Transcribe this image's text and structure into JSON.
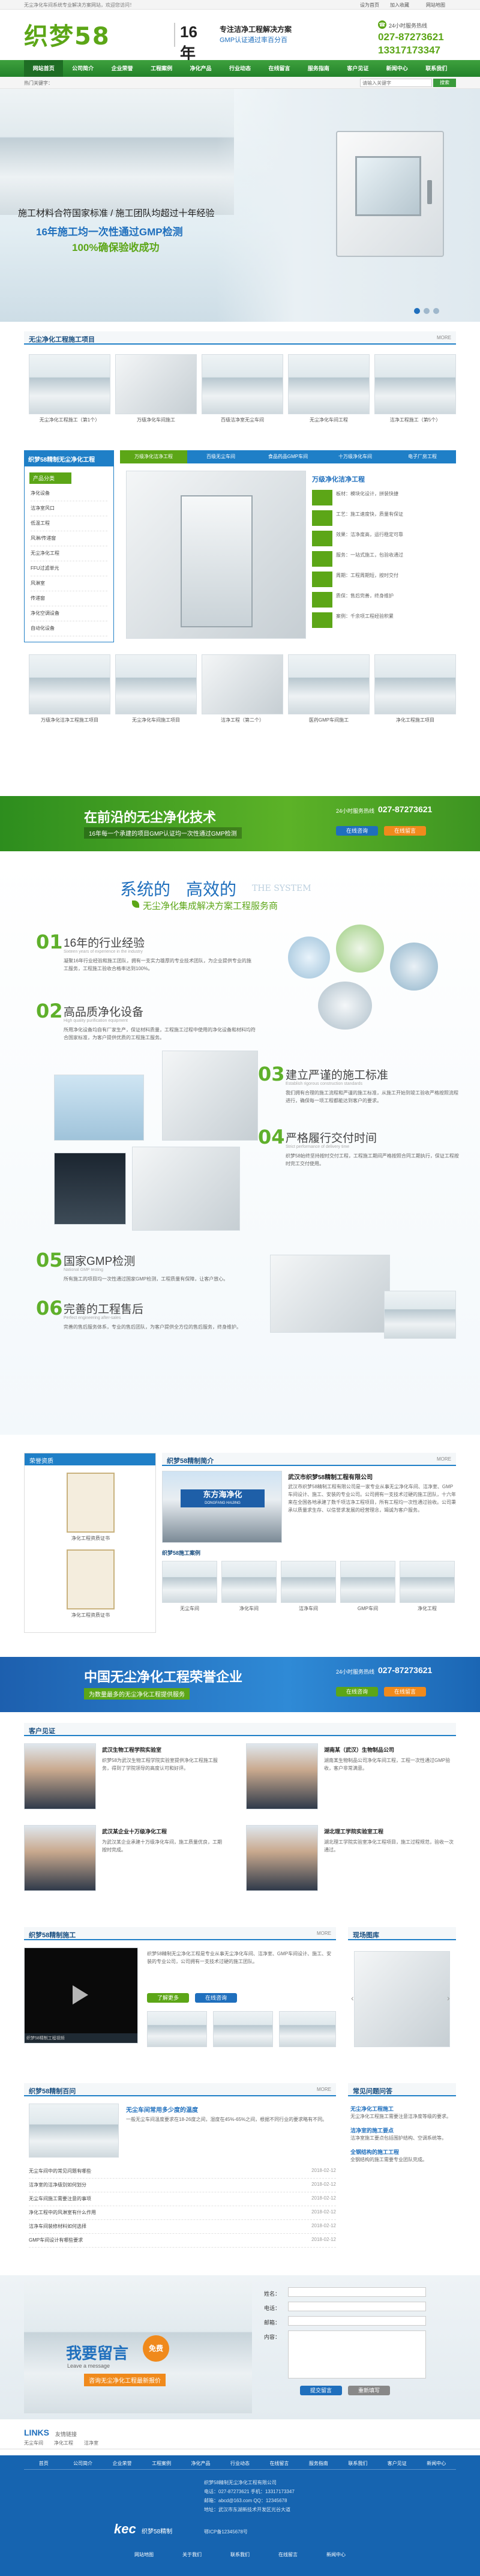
{
  "topbar": {
    "welcome": "无尘净化车间系统专业解决方案网站，欢迎您访问！",
    "links": [
      "设为首页",
      "加入收藏",
      "网站地图"
    ]
  },
  "header": {
    "logo": "织梦58",
    "tag_num": "16年",
    "tag1": "专注洁净工程解决方案",
    "tag2": "GMP认证通过率百分百",
    "hotline_label": "24小时服务热线",
    "phone1": "027-87273621",
    "phone2": "13317173347"
  },
  "nav": [
    "网站首页",
    "公司简介",
    "企业荣誉",
    "工程案例",
    "净化产品",
    "行业动态",
    "在线留言",
    "服务指南",
    "客户见证",
    "新闻中心",
    "联系我们"
  ],
  "search": {
    "label": "热门关键字：",
    "placeholder": "请输入关键字",
    "button": "搜索"
  },
  "banner": {
    "line1": "施工材料合符国家标准 / 施工团队均超过十年经验",
    "line2": "16年施工均一次性通过GMP检测",
    "line3": "100%确保验收成功"
  },
  "cases": {
    "title": "无尘净化工程施工项目",
    "more": "MORE",
    "items": [
      "无尘净化工程施工（第1个）",
      "万级净化车间施工",
      "百级洁净室无尘车间",
      "无尘净化车间工程",
      "洁净工程施工（第5个）"
    ]
  },
  "products": {
    "head": "织梦58精制无尘净化工程",
    "sidebar_title": "产品分类",
    "cats": [
      "净化设备",
      "洁净室风口",
      "低温工程",
      "风淋/传递窗",
      "无尘净化工程",
      "FFU过滤单元",
      "风淋室",
      "传递窗",
      "净化空调设备",
      "自动化设备"
    ],
    "tabs": [
      "万级净化洁净工程",
      "百级无尘车间",
      "食品药品GMP车间",
      "十万级净化车间",
      "电子厂房工程"
    ],
    "feat_title": "万级净化洁净工程",
    "features": [
      "板材：模块化设计，拼装快捷",
      "工艺：施工速度快，质量有保证",
      "效果：洁净度高，运行稳定可靠",
      "服务：一站式施工，包验收通过",
      "周期：工程周期短，按时交付",
      "质保：售后完善，终身维护",
      "案例：千余项工程经验积累"
    ],
    "thumbs": [
      "万级净化洁净工程施工项目",
      "无尘净化车间施工项目",
      "洁净工程（第二个）",
      "医药GMP车间施工",
      "净化工程施工项目"
    ]
  },
  "green_banner": {
    "title": "在前沿的无尘净化技术",
    "sub": "16年每一个承建的项目GMP认证均一次性通过GMP检测",
    "hotline_label": "24小时服务热线",
    "phone": "027-87273621",
    "b1": "在线咨询",
    "b2": "在线留言"
  },
  "system": {
    "t1": "系统的",
    "t2": "高效的",
    "en": "THE SYSTEM",
    "sub": "无尘净化集成解决方案工程服务商",
    "items": [
      {
        "n": "01",
        "t": "16年的行业经验",
        "en": "Sixteen years of experience in the industry",
        "d": "凝聚16年行业经验和施工团队，拥有一支实力雄厚的专业技术团队，为企业提供专业的施工服务，工程施工验收合格率达到100%。"
      },
      {
        "n": "02",
        "t": "高品质净化设备",
        "en": "High quality purification equipment",
        "d": "所用净化设备均自有厂家生产，保证材料质量，工程施工过程中使用的净化设备和材料均符合国家标准，为客户提供优质的工程施工服务。"
      },
      {
        "n": "03",
        "t": "建立严谨的施工标准",
        "en": "Establish rigorous construction standards",
        "d": "我们拥有合理的施工流程和严谨的施工标准，从施工开始到竣工验收严格按照流程进行，确保每一项工程都能达到客户的要求。"
      },
      {
        "n": "04",
        "t": "严格履行交付时间",
        "en": "Strict performance of delivery time",
        "d": "织梦58始终坚持按时交付工程，工程施工期间严格按照合同工期执行，保证工程按时完工交付使用。"
      },
      {
        "n": "05",
        "t": "国家GMP检测",
        "en": "National GMP testing",
        "d": "所有施工的项目均一次性通过国家GMP检测，工程质量有保障，让客户放心。"
      },
      {
        "n": "06",
        "t": "完善的工程售后",
        "en": "Perfect engineering after-sales",
        "d": "完善的售后服务体系，专业的售后团队，为客户提供全方位的售后服务，终身维护。"
      }
    ]
  },
  "about": {
    "cert_title": "荣誉资质",
    "cert_caps": [
      "净化工程资质证书",
      "净化工程资质证书"
    ],
    "title": "织梦58精制简介",
    "company": "武汉市织梦58精制工程有限公司",
    "text": "武汉市织梦58精制工程有限公司是一家专业从事无尘净化车间、洁净室、GMP车间设计、施工、安装的专业公司。公司拥有一支技术过硬的施工团队，十六年来在全国各地承建了数千项洁净工程项目，所有工程均一次性通过验收。公司秉承以质量求生存、以信誉求发展的经营理念，竭诚为客户服务。",
    "logo_name": "东方海净化",
    "logo_en": "DONGFANG HAIJING",
    "cases_title": "织梦58施工案例",
    "cases": [
      "无尘车间",
      "净化车间",
      "洁净车间",
      "GMP车间",
      "净化工程"
    ]
  },
  "blue_banner": {
    "title": "中国无尘净化工程荣誉企业",
    "sub": "为数量最多的无尘净化工程提供服务",
    "hotline_label": "24小时服务热线",
    "phone": "027-87273621",
    "b1": "在线咨询",
    "b2": "在线留言"
  },
  "clients": {
    "title": "客户见证",
    "items": [
      {
        "t": "武汉生物工程学院实验室",
        "d": "织梦58为武汉生物工程学院实验室提供净化工程施工服务，得到了学院领导的高度认可和好评。"
      },
      {
        "t": "湖南某（武汉）生物制品公司",
        "d": "湖南某生物制品公司净化车间工程，工程一次性通过GMP验收，客户非常满意。"
      },
      {
        "t": "武汉某企业十万级净化工程",
        "d": "为武汉某企业承建十万级净化车间，施工质量优良，工期按时完成。"
      },
      {
        "t": "湖北理工学院实验室工程",
        "d": "湖北理工学院实验室净化工程项目，施工过程规范，验收一次通过。"
      }
    ]
  },
  "video": {
    "title": "织梦58精制施工",
    "more": "MORE",
    "text": "织梦58精制无尘净化工程是专业从事无尘净化车间、洁净室、GMP车间设计、施工、安装的专业公司，公司拥有一支技术过硬的施工团队。",
    "b1": "了解更多",
    "b2": "在线咨询",
    "video_title": "织梦58精制工程视频"
  },
  "links_photos": {
    "title": "现场图库"
  },
  "faq": {
    "title": "织梦58精制百问",
    "more": "MORE",
    "top_title": "无尘车间常用多少度的温度",
    "top_d": "一般无尘车间温度要求在18-26度之间，湿度在45%-65%之间，根据不同行业的要求略有不同。",
    "items": [
      "无尘车间中的常见问题有哪些",
      "洁净室的洁净级别如何划分",
      "无尘车间施工需要注意的事项",
      "净化工程中的风淋室有什么作用",
      "洁净车间装修材料如何选择",
      "GMP车间设计有哪些要求"
    ],
    "dates": [
      "2018-02-12",
      "2018-02-12",
      "2018-02-12",
      "2018-02-12",
      "2018-02-12",
      "2018-02-12"
    ]
  },
  "news": {
    "title": "常见问题问答",
    "items": [
      {
        "t": "无尘净化工程施工",
        "d": "无尘净化工程施工需要注意洁净度等级的要求。"
      },
      {
        "t": "洁净室的施工要点",
        "d": "洁净室施工要点包括围护结构、空调系统等。"
      },
      {
        "t": "全钢结构的施工工程",
        "d": "全钢结构的施工需要专业团队完成。"
      }
    ]
  },
  "message": {
    "title": "我要留言",
    "title_en": "Leave a message",
    "free": "免费",
    "sub": "咨询无尘净化工程最新报价",
    "fields": [
      "姓名：",
      "电话：",
      "邮箱：",
      "内容："
    ],
    "submit": "提交留言",
    "reset": "重新填写"
  },
  "links": {
    "title": "LINKS",
    "title2": "友情链接",
    "items": [
      "无尘车间",
      "净化工程",
      "洁净室"
    ]
  },
  "footer": {
    "nav": [
      "首页",
      "公司简介",
      "企业荣誉",
      "工程案例",
      "净化产品",
      "行业动态",
      "在线留言",
      "服务指南",
      "联系我们",
      "客户见证",
      "新闻中心"
    ],
    "l1": "织梦58精制无尘净化工程有限公司",
    "l2": "电话：027-87273621 手机：13317173347",
    "l3": "邮箱：abcd@163.com QQ：12345678",
    "l4": "地址：武汉市东湖新技术开发区光谷大道",
    "logo": "kec",
    "logo_cn": "织梦58精制",
    "icp": "鄂ICP备12345678号",
    "bottom": [
      "网站地图",
      "关于我们",
      "联系我们",
      "在线留言",
      "新闻中心"
    ]
  },
  "colors": {
    "green": "#5ca617",
    "blue": "#1f6fbd",
    "nav": "#2c8a2c"
  }
}
